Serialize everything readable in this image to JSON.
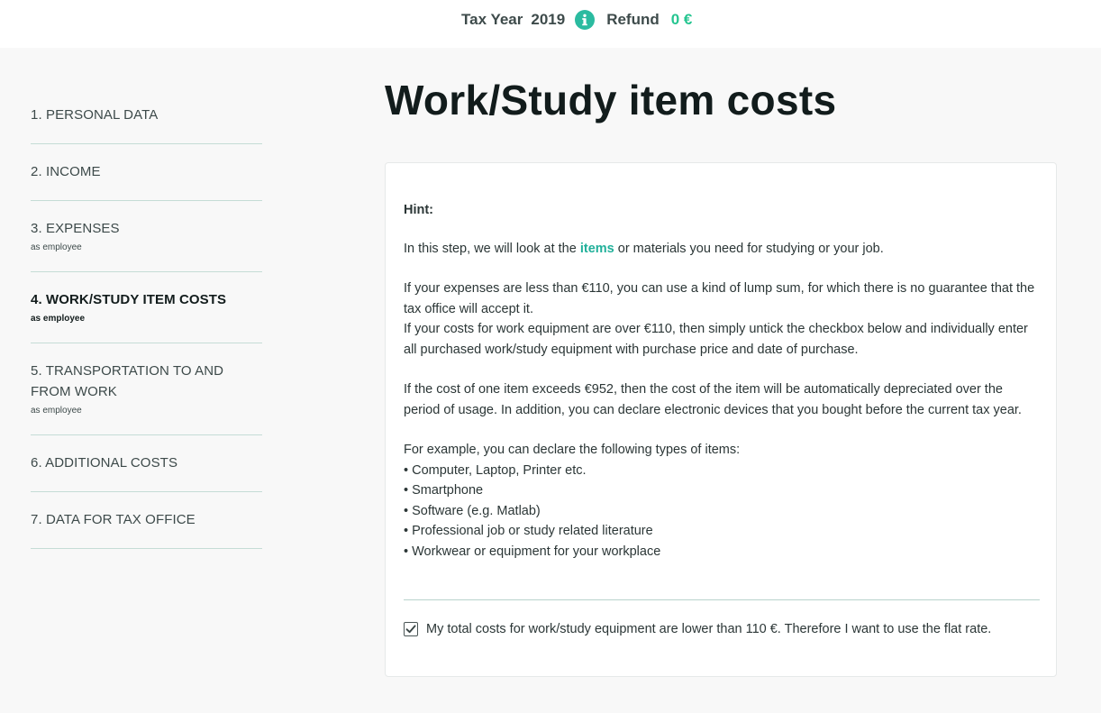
{
  "header": {
    "tax_year_label": "Tax Year",
    "tax_year_value": "2019",
    "info_icon": "info-icon",
    "refund_label": "Refund",
    "refund_value": "0 €",
    "refund_color": "#25c590"
  },
  "sidebar": {
    "items": [
      {
        "label": "1. PERSONAL DATA",
        "sub": ""
      },
      {
        "label": "2. INCOME",
        "sub": ""
      },
      {
        "label": "3. EXPENSES",
        "sub": "as employee"
      },
      {
        "label": "4. WORK/STUDY ITEM COSTS",
        "sub": "as employee",
        "active": true
      },
      {
        "label": "5. TRANSPORTATION TO AND FROM WORK",
        "sub": "as employee"
      },
      {
        "label": "6. ADDITIONAL COSTS",
        "sub": ""
      },
      {
        "label": "7. DATA FOR TAX OFFICE",
        "sub": ""
      }
    ]
  },
  "main": {
    "title": "Work/Study item costs",
    "hint_title": "Hint:",
    "para1_before": "In this step, we will look at the ",
    "para1_link": "items",
    "para1_after": " or materials you need for studying or your job.",
    "para2": "If your expenses are less than €110, you can use a kind of lump sum, for which there is no guarantee that the tax office will accept it.",
    "para3": "If your costs for work equipment are over €110, then simply untick the checkbox below and individually enter all purchased work/study equipment with purchase price and date of purchase.",
    "para4": "If the cost of one item exceeds €952, then the cost of the item will be automatically depreciated over the period of usage. In addition, you can declare electronic devices that you bought before the current tax year.",
    "para5": "For example, you can declare the following types of items:",
    "examples": [
      "Computer, Laptop, Printer etc.",
      "Smartphone",
      "Software (e.g. Matlab)",
      "Professional job or study related literature",
      "Workwear or equipment for your workplace"
    ],
    "checkbox_checked": true,
    "checkbox_label": "My total costs for work/study equipment are lower than 110 €. Therefore I want to use the flat rate.",
    "accent_color": "#21b09a"
  }
}
